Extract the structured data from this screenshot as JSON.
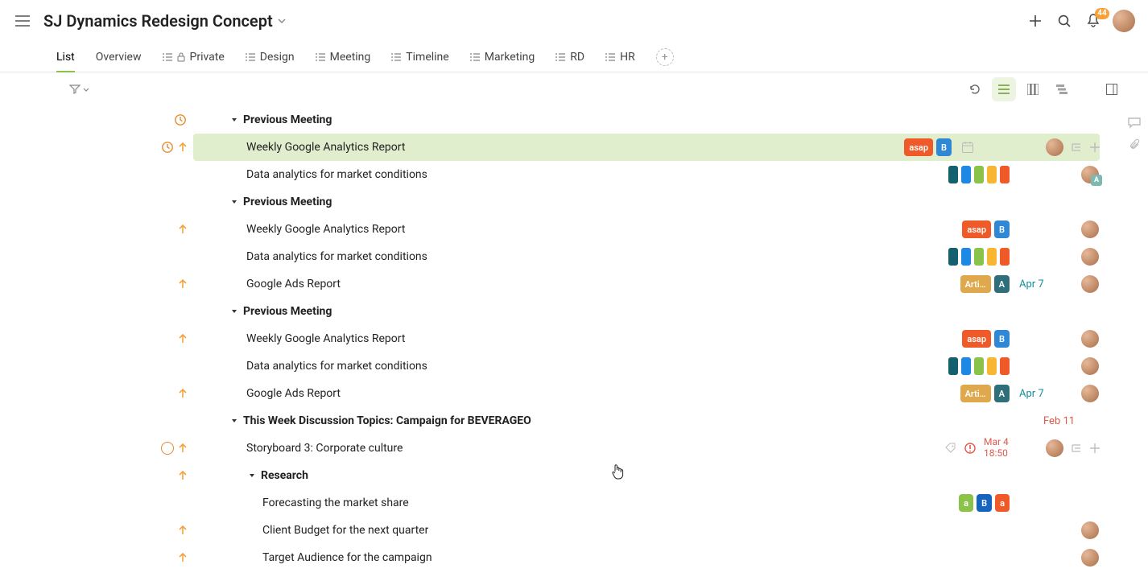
{
  "header": {
    "title": "SJ Dynamics Redesign Concept",
    "bellCount": "44"
  },
  "tabs": [
    {
      "label": "List",
      "active": true,
      "icon": "none"
    },
    {
      "label": "Overview",
      "icon": "none"
    },
    {
      "label": "Private",
      "icon": "lock"
    },
    {
      "label": "Design",
      "icon": "list"
    },
    {
      "label": "Meeting",
      "icon": "list"
    },
    {
      "label": "Timeline",
      "icon": "list"
    },
    {
      "label": "Marketing",
      "icon": "list"
    },
    {
      "label": "RD",
      "icon": "list"
    },
    {
      "label": "HR",
      "icon": "list"
    }
  ],
  "rows": [
    {
      "type": "section",
      "indent": 0,
      "text": "Previous Meeting",
      "gutterClock": true
    },
    {
      "type": "task",
      "indent": 1,
      "text": "Weekly Google Analytics Report",
      "highlight": true,
      "gutterClock": true,
      "gutterArrow": true,
      "tags": [
        {
          "label": "asap",
          "c": "#f05a28"
        },
        {
          "label": "B",
          "c": "#2f88d6"
        }
      ],
      "cal": true,
      "avatar": true,
      "actions": true
    },
    {
      "type": "task",
      "indent": 1,
      "text": "Data analytics for market conditions",
      "squares": [
        "#14606e",
        "#1e88e5",
        "#8bc34a",
        "#f7b733",
        "#f05a28"
      ],
      "avatar": true,
      "avatarTag": true
    },
    {
      "type": "section",
      "indent": 0,
      "text": "Previous Meeting"
    },
    {
      "type": "task",
      "indent": 1,
      "text": "Weekly Google Analytics Report",
      "gutterArrow": true,
      "tags": [
        {
          "label": "asap",
          "c": "#f05a28"
        },
        {
          "label": "B",
          "c": "#2f88d6"
        }
      ],
      "avatar": true
    },
    {
      "type": "task",
      "indent": 1,
      "text": "Data analytics for market conditions",
      "squares": [
        "#14606e",
        "#1e88e5",
        "#8bc34a",
        "#f7b733",
        "#f05a28"
      ],
      "avatar": true
    },
    {
      "type": "task",
      "indent": 1,
      "text": "Google Ads Report",
      "gutterArrow": true,
      "tags": [
        {
          "label": "Arti…",
          "c": "#e0a84c"
        },
        {
          "label": "A",
          "c": "#2f6f7a"
        }
      ],
      "date": "Apr 7",
      "avatar": true
    },
    {
      "type": "section",
      "indent": 0,
      "text": "Previous Meeting"
    },
    {
      "type": "task",
      "indent": 1,
      "text": "Weekly Google Analytics Report",
      "gutterArrow": true,
      "tags": [
        {
          "label": "asap",
          "c": "#f05a28"
        },
        {
          "label": "B",
          "c": "#2f88d6"
        }
      ],
      "avatar": true
    },
    {
      "type": "task",
      "indent": 1,
      "text": "Data analytics for market conditions",
      "squares": [
        "#14606e",
        "#1e88e5",
        "#8bc34a",
        "#f7b733",
        "#f05a28"
      ],
      "avatar": true
    },
    {
      "type": "task",
      "indent": 1,
      "text": "Google Ads Report",
      "gutterArrow": true,
      "tags": [
        {
          "label": "Arti…",
          "c": "#e0a84c"
        },
        {
          "label": "A",
          "c": "#2f6f7a"
        }
      ],
      "date": "Apr 7",
      "avatar": true
    },
    {
      "type": "section",
      "indent": 0,
      "text": "This Week Discussion Topics: Campaign for BEVERAGEO",
      "dateRed": "Feb 11"
    },
    {
      "type": "task",
      "indent": 1,
      "text": "Storyboard 3: Corporate culture",
      "gutterCircle": true,
      "gutterArrow": true,
      "tagIcon": true,
      "prio": true,
      "dateRedMulti": [
        "Mar 4",
        "18:50"
      ],
      "avatar": true,
      "actions": true,
      "hoverRow": true
    },
    {
      "type": "subsection",
      "indent": 1,
      "text": "Research",
      "gutterArrow": true
    },
    {
      "type": "task",
      "indent": 2,
      "text": "Forecasting the market share",
      "tags": [
        {
          "label": "a",
          "c": "#8bc34a"
        },
        {
          "label": "B",
          "c": "#1565c0"
        },
        {
          "label": "a",
          "c": "#f05a28"
        }
      ]
    },
    {
      "type": "task",
      "indent": 2,
      "text": "Client Budget for the next quarter",
      "gutterArrow": true,
      "avatar": true
    },
    {
      "type": "task",
      "indent": 2,
      "text": "Target Audience for the campaign",
      "gutterArrow": true,
      "avatar": true
    }
  ]
}
